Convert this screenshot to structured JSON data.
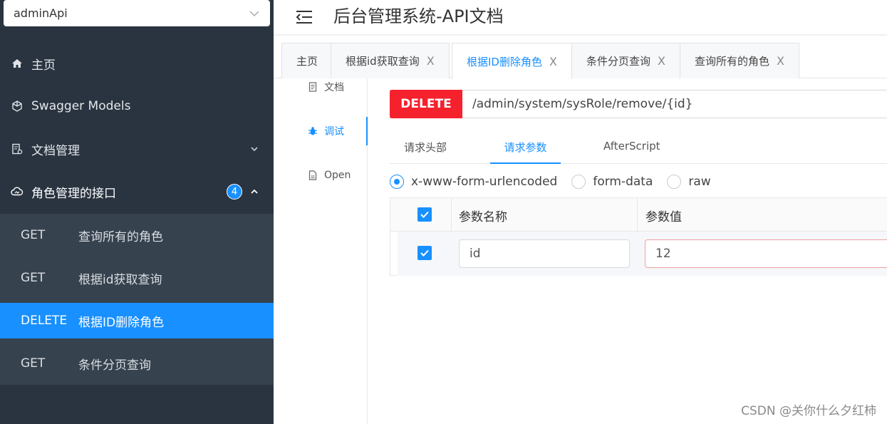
{
  "sidebar": {
    "group_select": "adminApi",
    "menu": [
      {
        "label": "主页",
        "icon": "home-icon"
      },
      {
        "label": "Swagger Models",
        "icon": "cube-icon"
      },
      {
        "label": "文档管理",
        "icon": "doc-gear-icon"
      },
      {
        "label": "角色管理的接口",
        "icon": "cloud-icon",
        "badge": "4"
      }
    ],
    "apis": [
      {
        "method": "GET",
        "name": "查询所有的角色"
      },
      {
        "method": "GET",
        "name": "根据id获取查询"
      },
      {
        "method": "DELETE",
        "name": "根据ID删除角色",
        "active": true
      },
      {
        "method": "GET",
        "name": "条件分页查询"
      }
    ]
  },
  "header": {
    "title": "后台管理系统-API文档"
  },
  "tabs": [
    {
      "label": "主页"
    },
    {
      "label": "根据id获取查询"
    },
    {
      "label": "根据ID删除角色",
      "active": true
    },
    {
      "label": "条件分页查询"
    },
    {
      "label": "查询所有的角色"
    }
  ],
  "tab_close": "X",
  "mini_nav": [
    {
      "label": "文档",
      "icon": "document-icon"
    },
    {
      "label": "调试",
      "icon": "bug-icon",
      "active": true
    },
    {
      "label": "Open",
      "icon": "file-icon"
    }
  ],
  "request": {
    "method": "DELETE",
    "url": "/admin/system/sysRole/remove/{id}",
    "tabs": [
      "请求头部",
      "请求参数",
      "AfterScript"
    ],
    "active_tab": "请求参数",
    "body_types": [
      "x-www-form-urlencoded",
      "form-data",
      "raw"
    ],
    "selected_body_type": "x-www-form-urlencoded",
    "table": {
      "headers": [
        "参数名称",
        "参数值"
      ],
      "rows": [
        {
          "checked": true,
          "name": "id",
          "value": "12"
        }
      ]
    }
  },
  "watermark": "CSDN @关你什么夕红柿",
  "colors": {
    "accent": "#1890ff",
    "delete": "#f5222d",
    "sidebar": "#2a3441"
  }
}
